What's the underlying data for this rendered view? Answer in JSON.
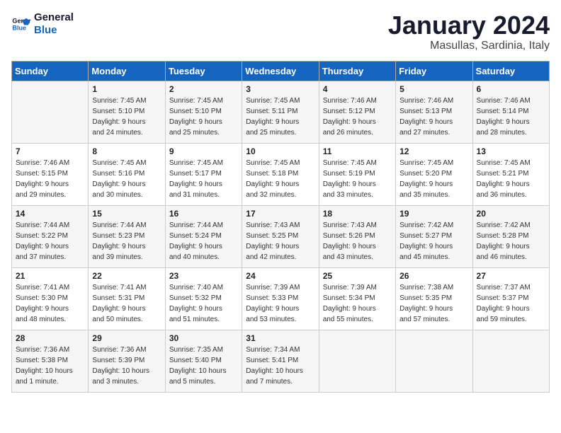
{
  "header": {
    "logo_line1": "General",
    "logo_line2": "Blue",
    "month": "January 2024",
    "location": "Masullas, Sardinia, Italy"
  },
  "days_of_week": [
    "Sunday",
    "Monday",
    "Tuesday",
    "Wednesday",
    "Thursday",
    "Friday",
    "Saturday"
  ],
  "weeks": [
    [
      {
        "day": "",
        "info": ""
      },
      {
        "day": "1",
        "info": "Sunrise: 7:45 AM\nSunset: 5:10 PM\nDaylight: 9 hours\nand 24 minutes."
      },
      {
        "day": "2",
        "info": "Sunrise: 7:45 AM\nSunset: 5:10 PM\nDaylight: 9 hours\nand 25 minutes."
      },
      {
        "day": "3",
        "info": "Sunrise: 7:45 AM\nSunset: 5:11 PM\nDaylight: 9 hours\nand 25 minutes."
      },
      {
        "day": "4",
        "info": "Sunrise: 7:46 AM\nSunset: 5:12 PM\nDaylight: 9 hours\nand 26 minutes."
      },
      {
        "day": "5",
        "info": "Sunrise: 7:46 AM\nSunset: 5:13 PM\nDaylight: 9 hours\nand 27 minutes."
      },
      {
        "day": "6",
        "info": "Sunrise: 7:46 AM\nSunset: 5:14 PM\nDaylight: 9 hours\nand 28 minutes."
      }
    ],
    [
      {
        "day": "7",
        "info": "Sunrise: 7:46 AM\nSunset: 5:15 PM\nDaylight: 9 hours\nand 29 minutes."
      },
      {
        "day": "8",
        "info": "Sunrise: 7:45 AM\nSunset: 5:16 PM\nDaylight: 9 hours\nand 30 minutes."
      },
      {
        "day": "9",
        "info": "Sunrise: 7:45 AM\nSunset: 5:17 PM\nDaylight: 9 hours\nand 31 minutes."
      },
      {
        "day": "10",
        "info": "Sunrise: 7:45 AM\nSunset: 5:18 PM\nDaylight: 9 hours\nand 32 minutes."
      },
      {
        "day": "11",
        "info": "Sunrise: 7:45 AM\nSunset: 5:19 PM\nDaylight: 9 hours\nand 33 minutes."
      },
      {
        "day": "12",
        "info": "Sunrise: 7:45 AM\nSunset: 5:20 PM\nDaylight: 9 hours\nand 35 minutes."
      },
      {
        "day": "13",
        "info": "Sunrise: 7:45 AM\nSunset: 5:21 PM\nDaylight: 9 hours\nand 36 minutes."
      }
    ],
    [
      {
        "day": "14",
        "info": "Sunrise: 7:44 AM\nSunset: 5:22 PM\nDaylight: 9 hours\nand 37 minutes."
      },
      {
        "day": "15",
        "info": "Sunrise: 7:44 AM\nSunset: 5:23 PM\nDaylight: 9 hours\nand 39 minutes."
      },
      {
        "day": "16",
        "info": "Sunrise: 7:44 AM\nSunset: 5:24 PM\nDaylight: 9 hours\nand 40 minutes."
      },
      {
        "day": "17",
        "info": "Sunrise: 7:43 AM\nSunset: 5:25 PM\nDaylight: 9 hours\nand 42 minutes."
      },
      {
        "day": "18",
        "info": "Sunrise: 7:43 AM\nSunset: 5:26 PM\nDaylight: 9 hours\nand 43 minutes."
      },
      {
        "day": "19",
        "info": "Sunrise: 7:42 AM\nSunset: 5:27 PM\nDaylight: 9 hours\nand 45 minutes."
      },
      {
        "day": "20",
        "info": "Sunrise: 7:42 AM\nSunset: 5:28 PM\nDaylight: 9 hours\nand 46 minutes."
      }
    ],
    [
      {
        "day": "21",
        "info": "Sunrise: 7:41 AM\nSunset: 5:30 PM\nDaylight: 9 hours\nand 48 minutes."
      },
      {
        "day": "22",
        "info": "Sunrise: 7:41 AM\nSunset: 5:31 PM\nDaylight: 9 hours\nand 50 minutes."
      },
      {
        "day": "23",
        "info": "Sunrise: 7:40 AM\nSunset: 5:32 PM\nDaylight: 9 hours\nand 51 minutes."
      },
      {
        "day": "24",
        "info": "Sunrise: 7:39 AM\nSunset: 5:33 PM\nDaylight: 9 hours\nand 53 minutes."
      },
      {
        "day": "25",
        "info": "Sunrise: 7:39 AM\nSunset: 5:34 PM\nDaylight: 9 hours\nand 55 minutes."
      },
      {
        "day": "26",
        "info": "Sunrise: 7:38 AM\nSunset: 5:35 PM\nDaylight: 9 hours\nand 57 minutes."
      },
      {
        "day": "27",
        "info": "Sunrise: 7:37 AM\nSunset: 5:37 PM\nDaylight: 9 hours\nand 59 minutes."
      }
    ],
    [
      {
        "day": "28",
        "info": "Sunrise: 7:36 AM\nSunset: 5:38 PM\nDaylight: 10 hours\nand 1 minute."
      },
      {
        "day": "29",
        "info": "Sunrise: 7:36 AM\nSunset: 5:39 PM\nDaylight: 10 hours\nand 3 minutes."
      },
      {
        "day": "30",
        "info": "Sunrise: 7:35 AM\nSunset: 5:40 PM\nDaylight: 10 hours\nand 5 minutes."
      },
      {
        "day": "31",
        "info": "Sunrise: 7:34 AM\nSunset: 5:41 PM\nDaylight: 10 hours\nand 7 minutes."
      },
      {
        "day": "",
        "info": ""
      },
      {
        "day": "",
        "info": ""
      },
      {
        "day": "",
        "info": ""
      }
    ]
  ]
}
